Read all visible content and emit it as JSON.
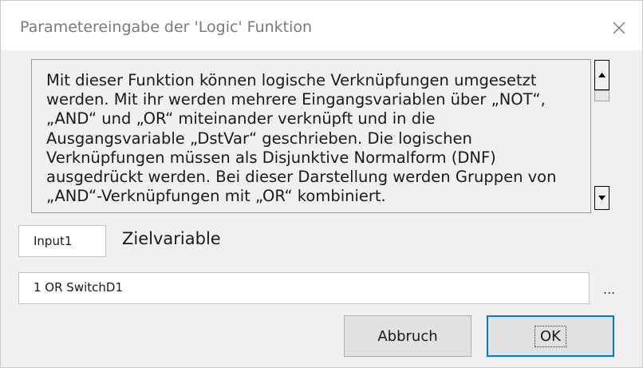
{
  "window": {
    "title": "Parametereingabe der 'Logic' Funktion",
    "close_icon": "close-icon"
  },
  "description": {
    "lines": [
      "Mit dieser Funktion können logische Verknüpfungen umgesetzt",
      "werden. Mit ihr werden mehrere Eingangsvariablen über „NOT“,",
      "„AND“ und „OR“ miteinander verknüpft und in die",
      "Ausgangsvariable „DstVar“ geschrieben. Die logischen",
      "Verknüpfungen müssen als Disjunktive Normalform (DNF)",
      "ausgedrückt werden. Bei dieser Darstellung werden Gruppen von",
      "„AND“-Verknüpfungen mit „OR“ kombiniert."
    ],
    "scroll_up_icon": "arrow-up-icon",
    "scroll_down_icon": "arrow-down-icon"
  },
  "target": {
    "value": "Input1",
    "label": "Zielvariable"
  },
  "expression": {
    "value": "1 OR SwitchD1",
    "browse_label": "..."
  },
  "buttons": {
    "cancel_label": "Abbruch",
    "ok_label": "OK"
  }
}
